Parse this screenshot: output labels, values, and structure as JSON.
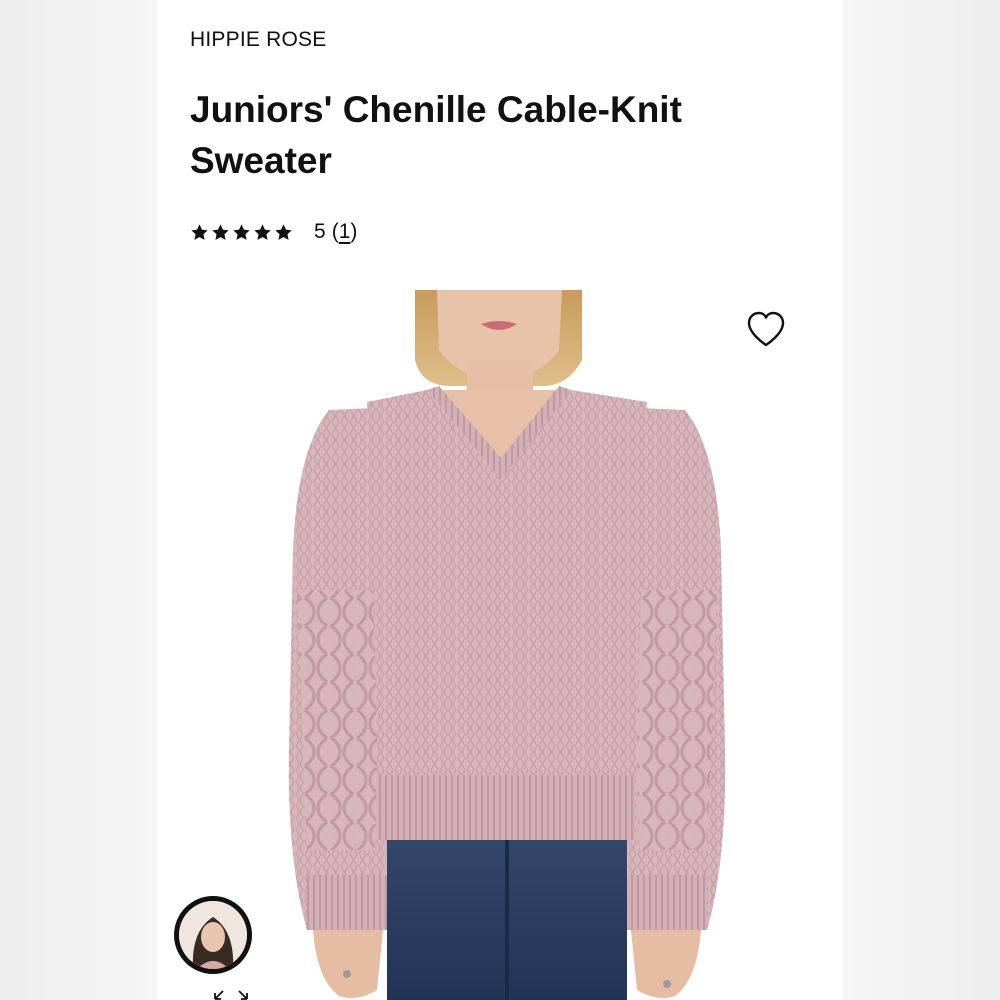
{
  "product": {
    "brand": "HIPPIE ROSE",
    "title": "Juniors' Chenille Cable-Knit Sweater",
    "rating": {
      "stars_filled": 5,
      "stars_total": 5,
      "value": "5",
      "review_count": "1"
    }
  },
  "icons": {
    "wishlist": "heart-outline-icon",
    "star": "star-filled-icon",
    "expand": "expand-arrows-icon"
  },
  "colors": {
    "sweater": "#d9b8bc",
    "text": "#111111",
    "jeans": "#2b3c5c"
  }
}
